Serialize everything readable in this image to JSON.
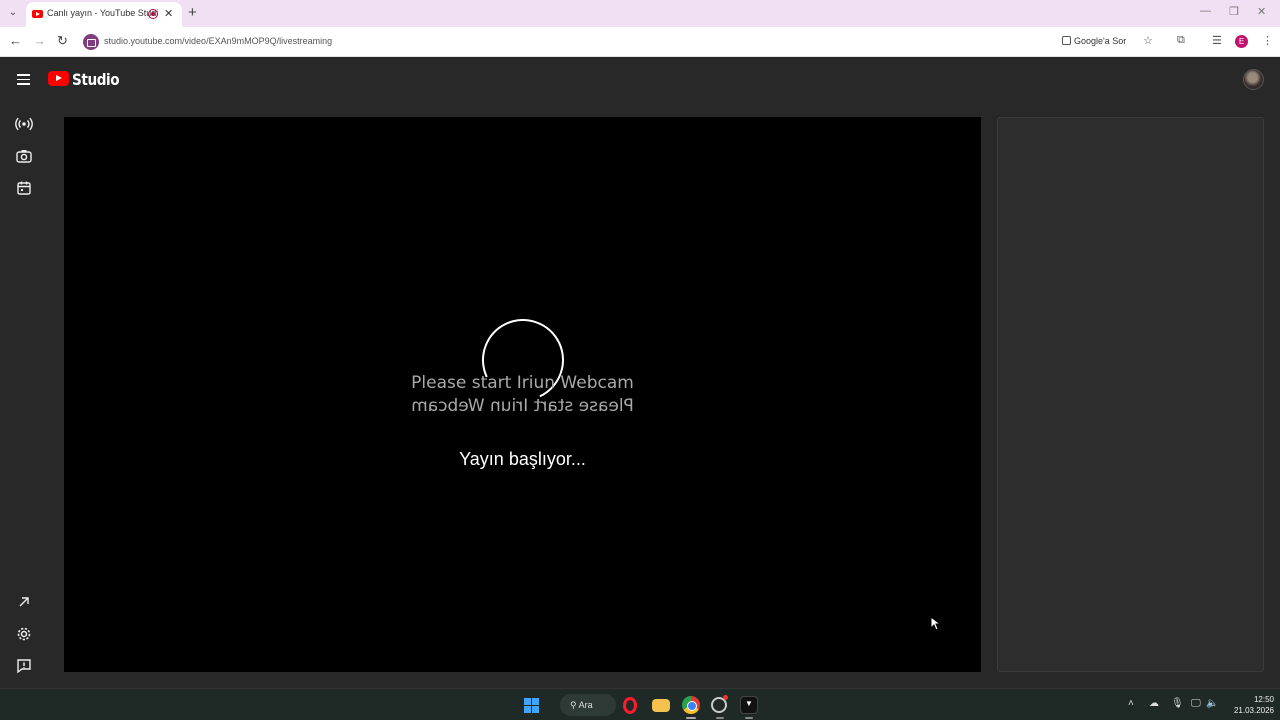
{
  "browser": {
    "tab_title": "Canlı yayın - YouTube Studi",
    "url": "studio.youtube.com/video/EXAn9mMOP9Q/livestreaming",
    "google_sor": "Google'a Sor",
    "profile_initial": "E"
  },
  "studio": {
    "logo_text": "Studio"
  },
  "player": {
    "camera_message": "Please start Iriun Webcam",
    "camera_message_mirrored": "Please start Iriun Webcam",
    "status": "Yayın başlıyor..."
  },
  "taskbar": {
    "search_label": "Ara",
    "time": "12:50",
    "date": "21.03.2026"
  }
}
